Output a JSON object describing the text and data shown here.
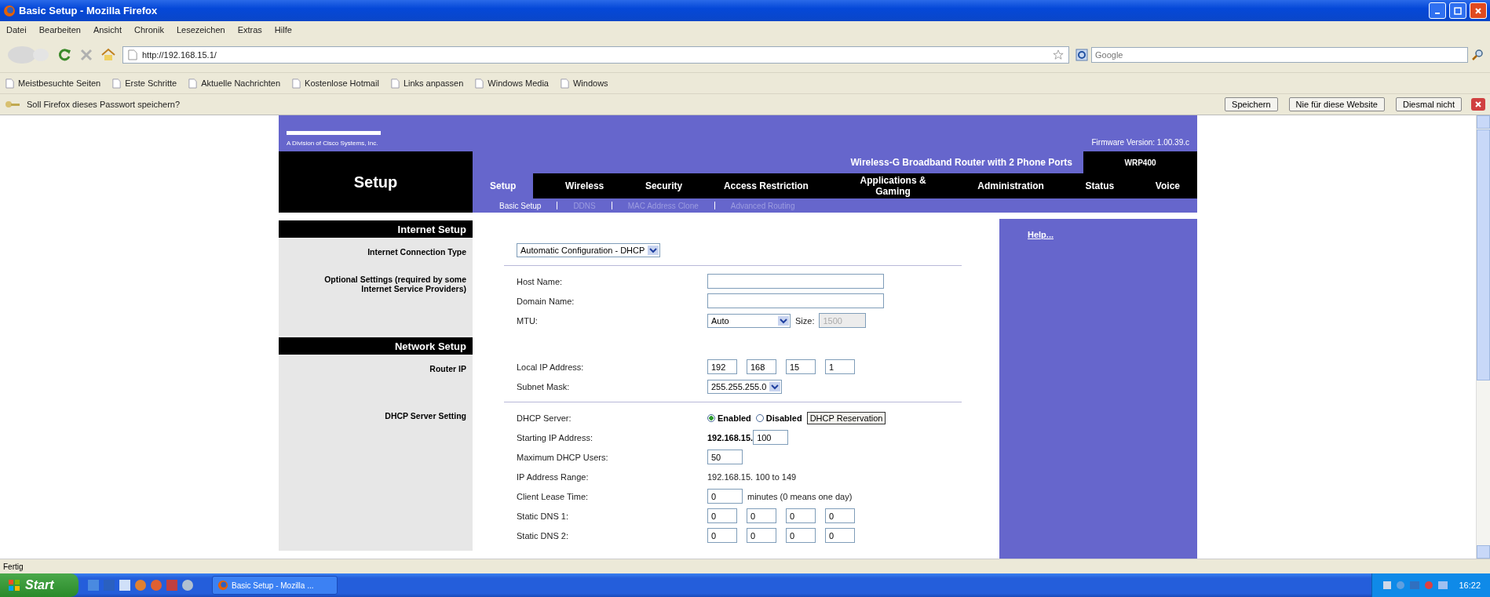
{
  "window": {
    "title": "Basic Setup - Mozilla Firefox"
  },
  "menu": [
    "Datei",
    "Bearbeiten",
    "Ansicht",
    "Chronik",
    "Lesezeichen",
    "Extras",
    "Hilfe"
  ],
  "address": {
    "value": "http://192.168.15.1/"
  },
  "search": {
    "placeholder": "Google"
  },
  "bookmarks": [
    "Meistbesuchte Seiten",
    "Erste Schritte",
    "Aktuelle Nachrichten",
    "Kostenlose Hotmail",
    "Links anpassen",
    "Windows Media",
    "Windows"
  ],
  "notification": {
    "text": "Soll Firefox dieses Passwort speichern?",
    "buttons": [
      "Speichern",
      "Nie für diese Website",
      "Diesmal nicht"
    ]
  },
  "router": {
    "subtitle": "A Division of Cisco Systems, Inc.",
    "firmware": "Firmware Version: 1.00.39.c",
    "product": "Wireless-G Broadband Router with 2 Phone Ports",
    "model": "WRP400",
    "section": "Setup",
    "tabs": [
      {
        "label": "Setup",
        "selected": true
      },
      {
        "label": "Wireless",
        "selected": false
      },
      {
        "label": "Security",
        "selected": false
      },
      {
        "label": "Access Restriction",
        "selected": false
      },
      {
        "label": "Applications & Gaming",
        "selected": false
      },
      {
        "label": "Administration",
        "selected": false
      },
      {
        "label": "Status",
        "selected": false
      },
      {
        "label": "Voice",
        "selected": false
      }
    ],
    "subtabs": [
      {
        "label": "Basic Setup",
        "selected": true
      },
      {
        "label": "DDNS",
        "selected": false
      },
      {
        "label": "MAC Address Clone",
        "selected": false
      },
      {
        "label": "Advanced Routing",
        "selected": false
      }
    ],
    "help": "Help...",
    "sections": [
      {
        "heading": "Internet Setup",
        "groups": [
          {
            "label": "Internet Connection Type",
            "rows": [
              {
                "kind": "select",
                "value": "Automatic Configuration - DHCP"
              }
            ]
          },
          {
            "label": "Optional Settings (required by some Internet Service Providers)",
            "rows": [
              {
                "kind": "input",
                "label": "Host Name:"
              },
              {
                "kind": "input",
                "label": "Domain Name:"
              },
              {
                "kind": "mtu",
                "label": "MTU:",
                "value": "Auto",
                "size_label": "Size:",
                "size": {
                  "value": "1500",
                  "disabled": true
                }
              }
            ]
          }
        ]
      },
      {
        "heading": "Network Setup",
        "groups": [
          {
            "label": "Router IP",
            "rows": [
              {
                "kind": "octets",
                "label": "Local IP Address:",
                "octets": [
                  "192",
                  "168",
                  "15",
                  "1"
                ]
              },
              {
                "kind": "select",
                "label": "Subnet Mask:",
                "value": "255.255.255.0"
              }
            ]
          },
          {
            "label": "DHCP Server Setting",
            "rows": [
              {
                "kind": "radio",
                "label": "DHCP Server:",
                "options": [
                  {
                    "label": "Enabled",
                    "selected": true
                  },
                  {
                    "label": "Disabled",
                    "selected": false
                  }
                ],
                "button": "DHCP Reservation"
              },
              {
                "kind": "input",
                "label": "Starting IP Address:",
                "prefix": "192.168.15.",
                "value": "100"
              },
              {
                "kind": "input",
                "label": "Maximum DHCP Users:",
                "value": "50"
              },
              {
                "kind": "static",
                "label": "IP Address Range:",
                "value": "192.168.15. 100 to 149"
              },
              {
                "kind": "input",
                "label": "Client Lease Time:",
                "value": "0",
                "suffix": "minutes (0 means one day)"
              },
              {
                "kind": "octets",
                "label": "Static DNS 1:",
                "octets": [
                  "0",
                  "0",
                  "0",
                  "0"
                ]
              },
              {
                "kind": "octets",
                "label": "Static DNS 2:",
                "octets": [
                  "0",
                  "0",
                  "0",
                  "0"
                ]
              }
            ]
          }
        ]
      }
    ]
  },
  "status_bar": {
    "text": "Fertig"
  },
  "taskbar": {
    "start": "Start",
    "task": "Basic Setup - Mozilla ...",
    "clock": "16:22"
  }
}
